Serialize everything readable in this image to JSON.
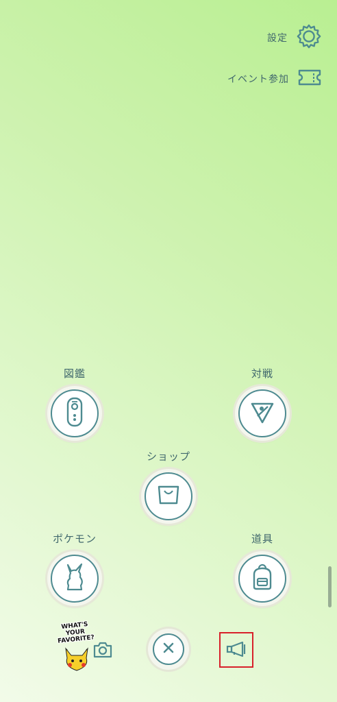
{
  "top_menu": {
    "settings_label": "設定",
    "event_label": "イベント参加"
  },
  "main_menu": {
    "pokedex_label": "図鑑",
    "battle_label": "対戦",
    "shop_label": "ショップ",
    "pokemon_label": "ポケモン",
    "items_label": "道具"
  },
  "badge": {
    "line1": "WHAT'S",
    "line2": "YOUR",
    "line3": "FAVORITE?"
  },
  "icons": {
    "settings": "gear-icon",
    "event": "ticket-icon",
    "pokedex": "pokedex-icon",
    "battle": "battle-league-icon",
    "shop": "shopping-bag-icon",
    "pokemon": "pikachu-silhouette-icon",
    "items": "backpack-icon",
    "camera": "camera-icon",
    "close": "close-icon",
    "news": "megaphone-icon"
  },
  "colors": {
    "icon_teal": "#4d8a90",
    "highlight_red": "#d8202a"
  }
}
